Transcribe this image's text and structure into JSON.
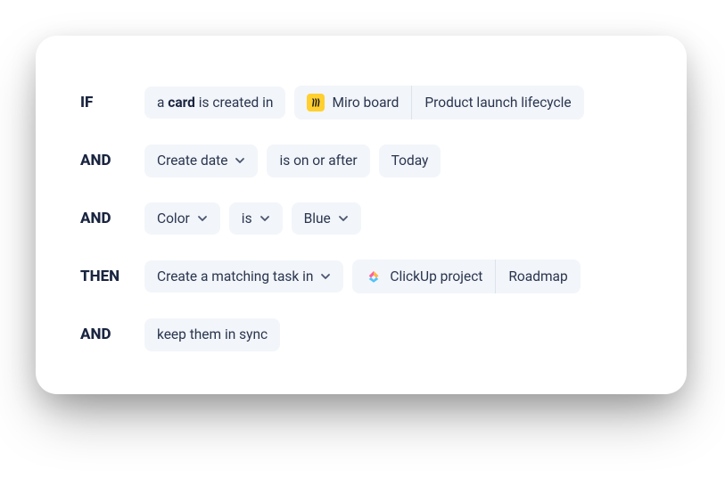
{
  "rows": [
    {
      "keyword": "IF",
      "trigger": {
        "prefix": "a ",
        "bold": "card",
        "suffix": " is created in"
      },
      "source": {
        "icon": "miro",
        "label": "Miro board",
        "name": "Product launch lifecycle"
      }
    },
    {
      "keyword": "AND",
      "condition": {
        "field": "Create date",
        "op": "is on or after",
        "value": "Today"
      }
    },
    {
      "keyword": "AND",
      "condition": {
        "field": "Color",
        "op": "is",
        "value": "Blue",
        "opHasChevron": true,
        "valueHasChevron": true
      }
    },
    {
      "keyword": "THEN",
      "action": {
        "label": "Create a matching task in"
      },
      "target": {
        "icon": "clickup",
        "label": "ClickUp project",
        "name": "Roadmap"
      }
    },
    {
      "keyword": "AND",
      "plain": "keep them in sync"
    }
  ]
}
